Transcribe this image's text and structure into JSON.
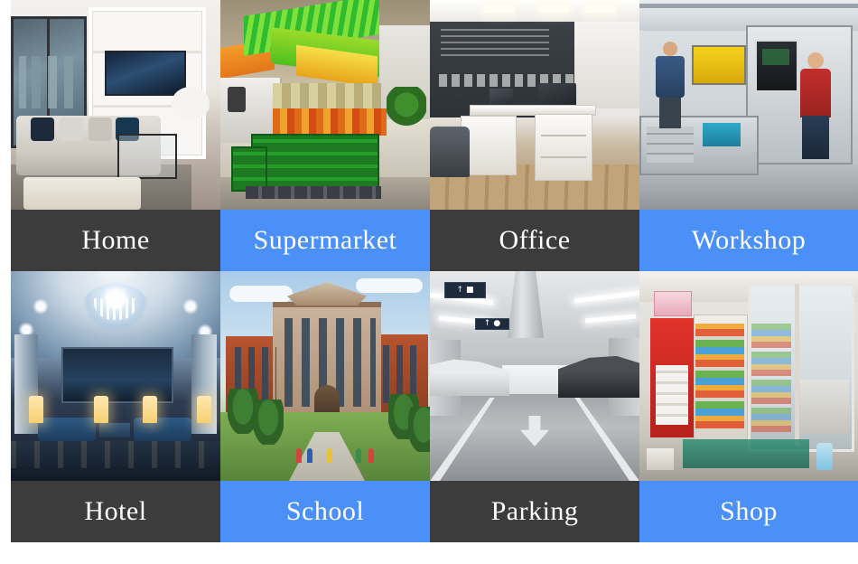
{
  "page": {
    "title": "Application Scenarios",
    "background_color": "#ffffff",
    "caption_dark_color": "#3c3c3c",
    "caption_blue_color": "#4a90f8",
    "caption_text_color": "#ffffff"
  },
  "grid": {
    "columns": 4,
    "rows": 2
  },
  "cards": [
    {
      "label": "Home",
      "caption_style": "dark",
      "photo_alt": "modern living room with grey sofa, wall-mounted TV and city view window"
    },
    {
      "label": "Supermarket",
      "caption_style": "blue",
      "photo_alt": "supermarket produce aisle with green crates and colorful ceiling"
    },
    {
      "label": "Office",
      "caption_style": "dark",
      "photo_alt": "open-plan office with white desks, cabinets and dark feature wall"
    },
    {
      "label": "Workshop",
      "caption_style": "blue",
      "photo_alt": "machine workshop with two workers at CNC machines and tool bench"
    },
    {
      "label": "Hotel",
      "caption_style": "dark",
      "photo_alt": "hotel lobby lounge with chandelier, blue sofas and table lamps"
    },
    {
      "label": "School",
      "caption_style": "blue",
      "photo_alt": "school campus building with brick wings, lawn and walking students"
    },
    {
      "label": "Parking",
      "caption_style": "dark",
      "photo_alt": "underground parking garage with strip lights, parked cars and floor arrow"
    },
    {
      "label": "Shop",
      "caption_style": "blue",
      "photo_alt": "convenience shop entrance with glass doors, red display stand and product shelves"
    }
  ],
  "parking_signs": {
    "sign_1": {
      "arrow": "↑",
      "pictogram": "Ὡ7"
    },
    "sign_2": {
      "arrow": "↑",
      "pictogram": "♟"
    }
  }
}
